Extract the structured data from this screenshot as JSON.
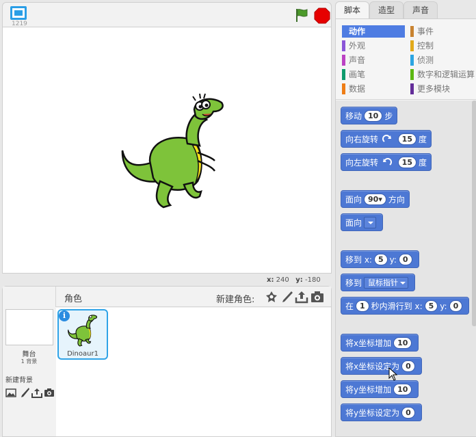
{
  "stage": {
    "version": "1219",
    "coords": {
      "x_label": "x:",
      "x_value": "240",
      "y_label": "y:",
      "y_value": "-180"
    }
  },
  "sprites_panel": {
    "title": "角色",
    "new_sprite_label": "新建角色:",
    "stage_name": "舞台",
    "backdrop_count": "1 背景",
    "new_backdrop_label": "新建背景",
    "sprites": [
      {
        "name": "Dinoaur1",
        "info": "i"
      }
    ]
  },
  "tabs": [
    "脚本",
    "造型",
    "声音"
  ],
  "categories": [
    {
      "label": "动作",
      "color": "#4a6cd4",
      "active": true
    },
    {
      "label": "事件",
      "color": "#c88330"
    },
    {
      "label": "外观",
      "color": "#8a55d7"
    },
    {
      "label": "控制",
      "color": "#e1a91a"
    },
    {
      "label": "声音",
      "color": "#bb42c3"
    },
    {
      "label": "侦测",
      "color": "#2ca5e2"
    },
    {
      "label": "画笔",
      "color": "#0e9a6c"
    },
    {
      "label": "数字和逻辑运算",
      "color": "#5cb712"
    },
    {
      "label": "数据",
      "color": "#ee7d16"
    },
    {
      "label": "更多模块",
      "color": "#632d99"
    }
  ],
  "blocks": {
    "move": {
      "t1": "移动",
      "v": "10",
      "t2": "步"
    },
    "turn_right": {
      "t1": "向右旋转",
      "v": "15",
      "t2": "度"
    },
    "turn_left": {
      "t1": "向左旋转",
      "v": "15",
      "t2": "度"
    },
    "point_dir": {
      "t1": "面向",
      "v": "90▾",
      "t2": "方向"
    },
    "point_towards": {
      "t1": "面向"
    },
    "goto_xy": {
      "t1": "移到 x:",
      "x": "5",
      "t2": "y:",
      "y": "0"
    },
    "goto": {
      "t1": "移到",
      "v": "鼠标指针"
    },
    "glide": {
      "t1": "在",
      "v": "1",
      "t2": "秒内滑行到 x:",
      "x": "5",
      "t3": "y:",
      "y": "0"
    },
    "change_x": {
      "t1": "将x坐标增加",
      "v": "10"
    },
    "set_x": {
      "t1": "将x坐标设定为",
      "v": "0"
    },
    "change_y": {
      "t1": "将y坐标增加",
      "v": "10"
    },
    "set_y": {
      "t1": "将y坐标设定为",
      "v": "0"
    }
  }
}
